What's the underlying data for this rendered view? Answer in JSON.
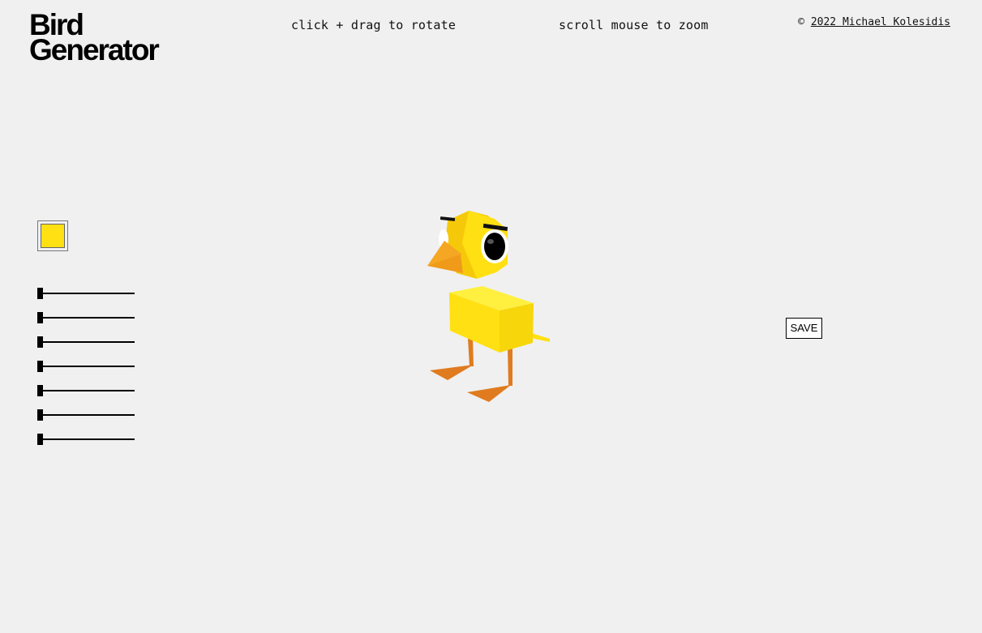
{
  "app": {
    "title_line1": "Bird",
    "title_line2": "Generator"
  },
  "hints": {
    "rotate": "click + drag to rotate",
    "zoom": "scroll mouse to zoom"
  },
  "credit": {
    "symbol": "©",
    "link_text": "2022 Michael Kolesidis"
  },
  "controls": {
    "body_color": "#ffe012",
    "sliders": [
      {
        "name": "slider-1",
        "value": 0
      },
      {
        "name": "slider-2",
        "value": 0
      },
      {
        "name": "slider-3",
        "value": 0
      },
      {
        "name": "slider-4",
        "value": 0
      },
      {
        "name": "slider-5",
        "value": 0
      },
      {
        "name": "slider-6",
        "value": 0
      },
      {
        "name": "slider-7",
        "value": 0
      }
    ]
  },
  "actions": {
    "save_label": "SAVE"
  },
  "colors": {
    "background": "#f0f0f0",
    "bird_body": "#ffe012",
    "bird_beak": "#f5a623",
    "bird_legs": "#e07b20",
    "eye": "#000000"
  },
  "icons": {
    "bird": "3d-bird-model"
  }
}
